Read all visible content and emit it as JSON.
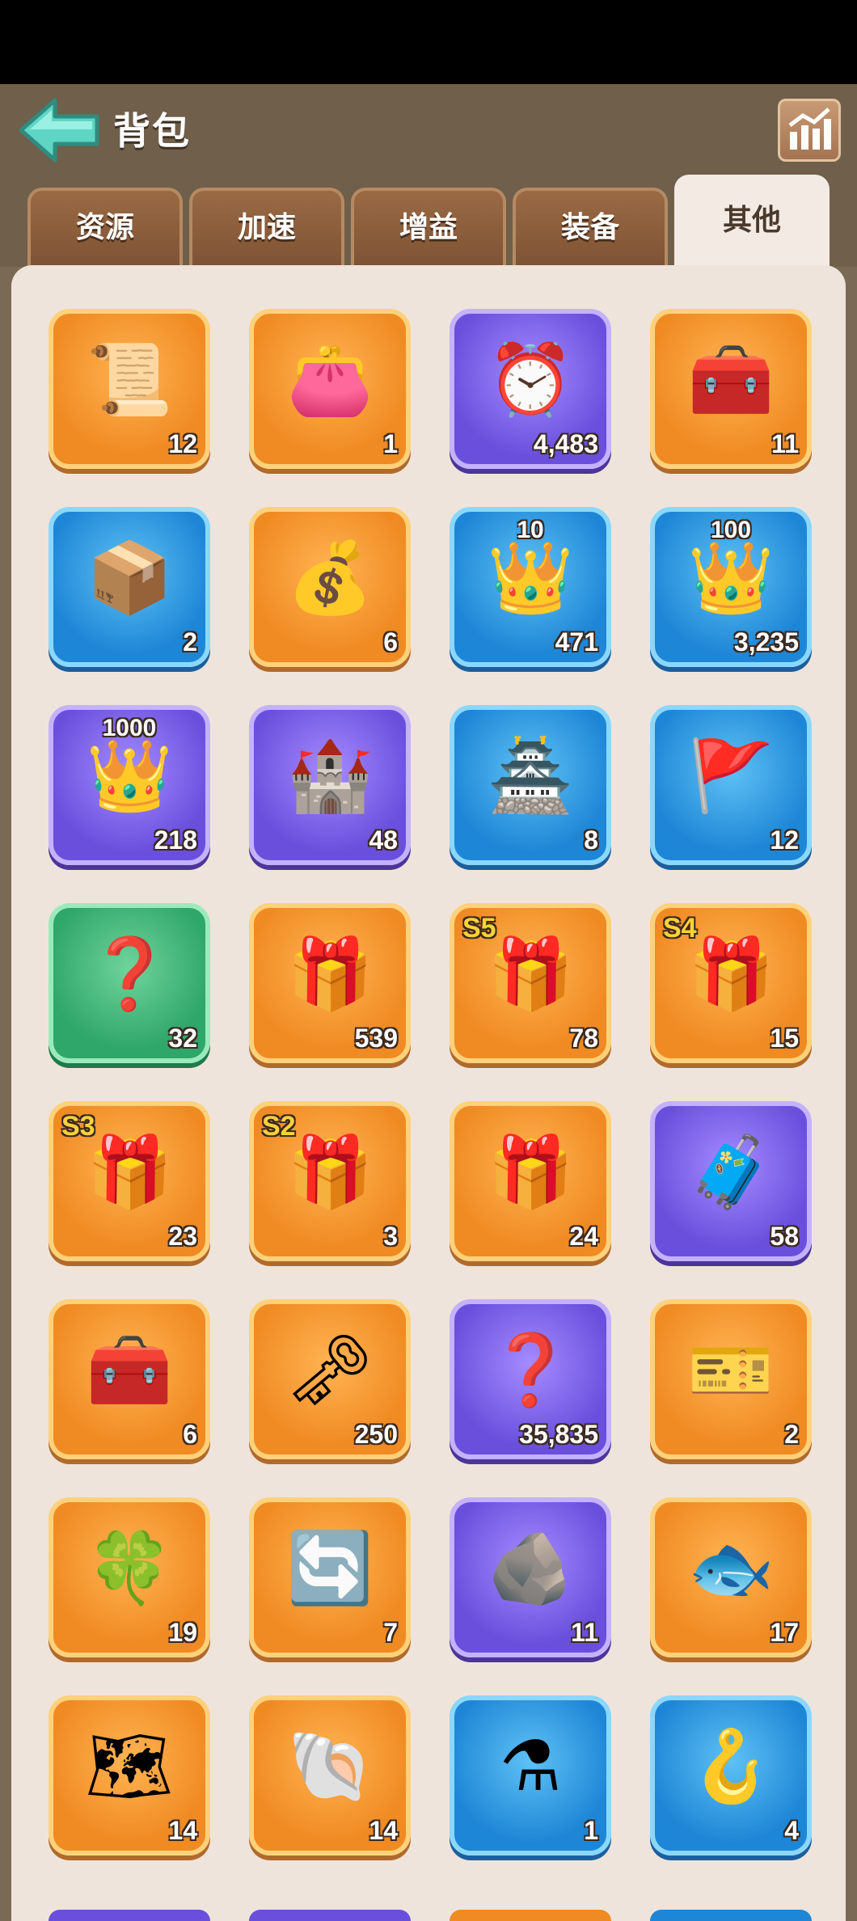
{
  "header": {
    "title": "背包"
  },
  "tabs": [
    {
      "label": "资源",
      "active": false
    },
    {
      "label": "加速",
      "active": false
    },
    {
      "label": "增益",
      "active": false
    },
    {
      "label": "装备",
      "active": false
    },
    {
      "label": "其他",
      "active": true
    }
  ],
  "colors": {
    "orange": "#f08a22",
    "blue": "#1e86d6",
    "purple": "#6a4fdd",
    "green": "#2fa66a"
  },
  "items": [
    {
      "icon": "scroll-decree-icon",
      "glyph": "📜",
      "bg": "orange",
      "count": "12"
    },
    {
      "icon": "treasure-bags-icon",
      "glyph": "👛",
      "bg": "orange",
      "count": "1"
    },
    {
      "icon": "speedup-clock-icon",
      "glyph": "⏰",
      "bg": "purple",
      "count": "4,483"
    },
    {
      "icon": "mystery-chest-armor-icon",
      "glyph": "🧰",
      "bg": "orange",
      "count": "11"
    },
    {
      "icon": "crystal-crate-icon",
      "glyph": "📦",
      "bg": "blue",
      "count": "2"
    },
    {
      "icon": "blue-pouch-icon",
      "glyph": "💰",
      "bg": "orange",
      "count": "6"
    },
    {
      "icon": "gold-crown-shield-icon",
      "glyph": "👑",
      "bg": "blue",
      "count": "471",
      "badge": "10"
    },
    {
      "icon": "gold-crown-shield-icon",
      "glyph": "👑",
      "bg": "blue",
      "count": "3,235",
      "badge": "100"
    },
    {
      "icon": "gold-crown-shield-icon",
      "glyph": "👑",
      "bg": "purple",
      "count": "218",
      "badge": "1000"
    },
    {
      "icon": "castle-relocate-icon",
      "glyph": "🏰",
      "bg": "purple",
      "count": "48"
    },
    {
      "icon": "city-relocate-icon",
      "glyph": "🏯",
      "bg": "blue",
      "count": "8"
    },
    {
      "icon": "alliance-banner-teleport-icon",
      "glyph": "🚩",
      "bg": "blue",
      "count": "12"
    },
    {
      "icon": "random-teleport-icon",
      "glyph": "❓",
      "bg": "green",
      "count": "32"
    },
    {
      "icon": "treasure-chest-icon",
      "glyph": "🎁",
      "bg": "orange",
      "count": "539"
    },
    {
      "icon": "season-chest-icon",
      "glyph": "🎁",
      "bg": "orange",
      "count": "78",
      "season": "S5"
    },
    {
      "icon": "season-chest-icon",
      "glyph": "🎁",
      "bg": "orange",
      "count": "15",
      "season": "S4"
    },
    {
      "icon": "season-chest-icon",
      "glyph": "🎁",
      "bg": "orange",
      "count": "23",
      "season": "S3"
    },
    {
      "icon": "season-chest-icon",
      "glyph": "🎁",
      "bg": "orange",
      "count": "3",
      "season": "S2"
    },
    {
      "icon": "red-chest-icon",
      "glyph": "🎁",
      "bg": "orange",
      "count": "24"
    },
    {
      "icon": "silver-chest-icon",
      "glyph": "🧳",
      "bg": "purple",
      "count": "58"
    },
    {
      "icon": "red-gold-chest-icon",
      "glyph": "🧰",
      "bg": "orange",
      "count": "6"
    },
    {
      "icon": "golden-key-icon",
      "glyph": "🗝",
      "bg": "orange",
      "count": "250"
    },
    {
      "icon": "mystery-medal-icon",
      "glyph": "❓",
      "bg": "purple",
      "count": "35,835"
    },
    {
      "icon": "purple-ticket-icon",
      "glyph": "🎫",
      "bg": "orange",
      "count": "2"
    },
    {
      "icon": "clover-coin-icon",
      "glyph": "🍀",
      "bg": "orange",
      "count": "19"
    },
    {
      "icon": "refresh-ticket-icon",
      "glyph": "🔄",
      "bg": "orange",
      "count": "7"
    },
    {
      "icon": "stone-block-icon",
      "glyph": "🪨",
      "bg": "purple",
      "count": "11"
    },
    {
      "icon": "fish-plaque-icon",
      "glyph": "🐟",
      "bg": "orange",
      "count": "17"
    },
    {
      "icon": "treasure-map-icon",
      "glyph": "🗺",
      "bg": "orange",
      "count": "14"
    },
    {
      "icon": "conch-shell-icon",
      "glyph": "🐚",
      "bg": "orange",
      "count": "14"
    },
    {
      "icon": "potion-flask-icon",
      "glyph": "⚗",
      "bg": "blue",
      "count": "1"
    },
    {
      "icon": "fishing-lure-icon",
      "glyph": "🪝",
      "bg": "blue",
      "count": "4"
    }
  ]
}
